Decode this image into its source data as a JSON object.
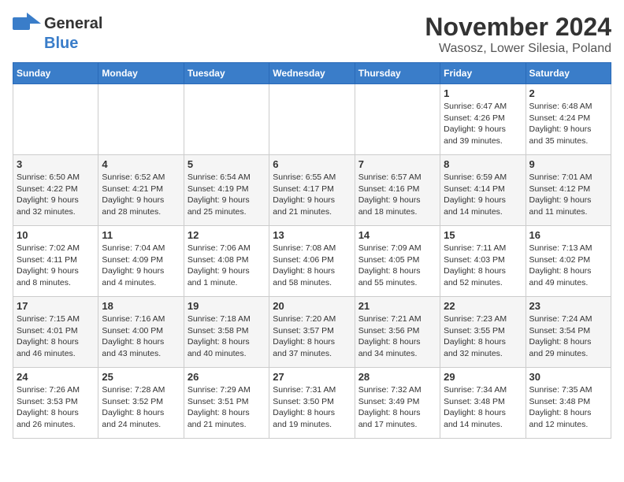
{
  "logo": {
    "general": "General",
    "blue": "Blue"
  },
  "title": "November 2024",
  "location": "Wasosz, Lower Silesia, Poland",
  "weekdays": [
    "Sunday",
    "Monday",
    "Tuesday",
    "Wednesday",
    "Thursday",
    "Friday",
    "Saturday"
  ],
  "weeks": [
    [
      {
        "day": "",
        "info": ""
      },
      {
        "day": "",
        "info": ""
      },
      {
        "day": "",
        "info": ""
      },
      {
        "day": "",
        "info": ""
      },
      {
        "day": "",
        "info": ""
      },
      {
        "day": "1",
        "info": "Sunrise: 6:47 AM\nSunset: 4:26 PM\nDaylight: 9 hours\nand 39 minutes."
      },
      {
        "day": "2",
        "info": "Sunrise: 6:48 AM\nSunset: 4:24 PM\nDaylight: 9 hours\nand 35 minutes."
      }
    ],
    [
      {
        "day": "3",
        "info": "Sunrise: 6:50 AM\nSunset: 4:22 PM\nDaylight: 9 hours\nand 32 minutes."
      },
      {
        "day": "4",
        "info": "Sunrise: 6:52 AM\nSunset: 4:21 PM\nDaylight: 9 hours\nand 28 minutes."
      },
      {
        "day": "5",
        "info": "Sunrise: 6:54 AM\nSunset: 4:19 PM\nDaylight: 9 hours\nand 25 minutes."
      },
      {
        "day": "6",
        "info": "Sunrise: 6:55 AM\nSunset: 4:17 PM\nDaylight: 9 hours\nand 21 minutes."
      },
      {
        "day": "7",
        "info": "Sunrise: 6:57 AM\nSunset: 4:16 PM\nDaylight: 9 hours\nand 18 minutes."
      },
      {
        "day": "8",
        "info": "Sunrise: 6:59 AM\nSunset: 4:14 PM\nDaylight: 9 hours\nand 14 minutes."
      },
      {
        "day": "9",
        "info": "Sunrise: 7:01 AM\nSunset: 4:12 PM\nDaylight: 9 hours\nand 11 minutes."
      }
    ],
    [
      {
        "day": "10",
        "info": "Sunrise: 7:02 AM\nSunset: 4:11 PM\nDaylight: 9 hours\nand 8 minutes."
      },
      {
        "day": "11",
        "info": "Sunrise: 7:04 AM\nSunset: 4:09 PM\nDaylight: 9 hours\nand 4 minutes."
      },
      {
        "day": "12",
        "info": "Sunrise: 7:06 AM\nSunset: 4:08 PM\nDaylight: 9 hours\nand 1 minute."
      },
      {
        "day": "13",
        "info": "Sunrise: 7:08 AM\nSunset: 4:06 PM\nDaylight: 8 hours\nand 58 minutes."
      },
      {
        "day": "14",
        "info": "Sunrise: 7:09 AM\nSunset: 4:05 PM\nDaylight: 8 hours\nand 55 minutes."
      },
      {
        "day": "15",
        "info": "Sunrise: 7:11 AM\nSunset: 4:03 PM\nDaylight: 8 hours\nand 52 minutes."
      },
      {
        "day": "16",
        "info": "Sunrise: 7:13 AM\nSunset: 4:02 PM\nDaylight: 8 hours\nand 49 minutes."
      }
    ],
    [
      {
        "day": "17",
        "info": "Sunrise: 7:15 AM\nSunset: 4:01 PM\nDaylight: 8 hours\nand 46 minutes."
      },
      {
        "day": "18",
        "info": "Sunrise: 7:16 AM\nSunset: 4:00 PM\nDaylight: 8 hours\nand 43 minutes."
      },
      {
        "day": "19",
        "info": "Sunrise: 7:18 AM\nSunset: 3:58 PM\nDaylight: 8 hours\nand 40 minutes."
      },
      {
        "day": "20",
        "info": "Sunrise: 7:20 AM\nSunset: 3:57 PM\nDaylight: 8 hours\nand 37 minutes."
      },
      {
        "day": "21",
        "info": "Sunrise: 7:21 AM\nSunset: 3:56 PM\nDaylight: 8 hours\nand 34 minutes."
      },
      {
        "day": "22",
        "info": "Sunrise: 7:23 AM\nSunset: 3:55 PM\nDaylight: 8 hours\nand 32 minutes."
      },
      {
        "day": "23",
        "info": "Sunrise: 7:24 AM\nSunset: 3:54 PM\nDaylight: 8 hours\nand 29 minutes."
      }
    ],
    [
      {
        "day": "24",
        "info": "Sunrise: 7:26 AM\nSunset: 3:53 PM\nDaylight: 8 hours\nand 26 minutes."
      },
      {
        "day": "25",
        "info": "Sunrise: 7:28 AM\nSunset: 3:52 PM\nDaylight: 8 hours\nand 24 minutes."
      },
      {
        "day": "26",
        "info": "Sunrise: 7:29 AM\nSunset: 3:51 PM\nDaylight: 8 hours\nand 21 minutes."
      },
      {
        "day": "27",
        "info": "Sunrise: 7:31 AM\nSunset: 3:50 PM\nDaylight: 8 hours\nand 19 minutes."
      },
      {
        "day": "28",
        "info": "Sunrise: 7:32 AM\nSunset: 3:49 PM\nDaylight: 8 hours\nand 17 minutes."
      },
      {
        "day": "29",
        "info": "Sunrise: 7:34 AM\nSunset: 3:48 PM\nDaylight: 8 hours\nand 14 minutes."
      },
      {
        "day": "30",
        "info": "Sunrise: 7:35 AM\nSunset: 3:48 PM\nDaylight: 8 hours\nand 12 minutes."
      }
    ]
  ]
}
